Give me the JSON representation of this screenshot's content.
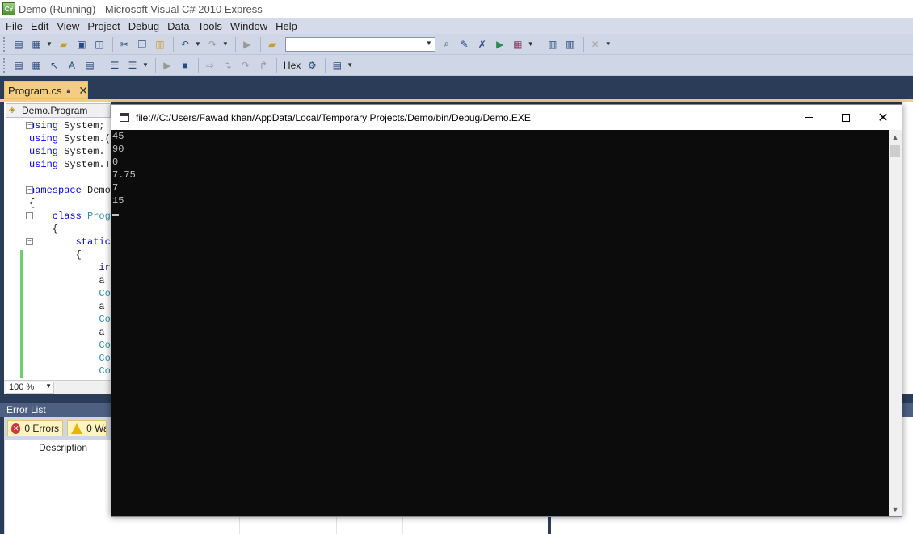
{
  "vs": {
    "title": "Demo (Running) - Microsoft Visual C# 2010 Express",
    "app_icon": "C#"
  },
  "menu": [
    "File",
    "Edit",
    "View",
    "Project",
    "Debug",
    "Data",
    "Tools",
    "Window",
    "Help"
  ],
  "toolbar": {
    "hex_label": "Hex"
  },
  "document_tab": {
    "label": "Program.cs",
    "pin_icon": "lock-icon",
    "close_icon": "close-icon"
  },
  "editor": {
    "nav_label": "Demo.Program",
    "zoom": "100 %",
    "lines": [
      {
        "kw": "using",
        "rest": " System;"
      },
      {
        "kw": "using",
        "rest": " System.("
      },
      {
        "kw": "using",
        "rest": " System."
      },
      {
        "kw": "using",
        "rest": " System.T"
      },
      {
        "kw": "",
        "rest": ""
      },
      {
        "kw": "namespace",
        "rest": " Demo"
      },
      {
        "kw": "",
        "rest": "{"
      },
      {
        "kw": "    class",
        "rest": " Prog"
      },
      {
        "kw": "",
        "rest": "    {"
      },
      {
        "kw": "        static",
        "rest": ""
      },
      {
        "kw": "",
        "rest": "        {"
      },
      {
        "kw": "            ir",
        "rest": ""
      },
      {
        "kw": "",
        "rest": "            a"
      },
      {
        "kw": "",
        "rest": "            Co"
      },
      {
        "kw": "",
        "rest": "            a"
      },
      {
        "kw": "",
        "rest": "            Co"
      },
      {
        "kw": "",
        "rest": "            a"
      },
      {
        "kw": "",
        "rest": "            Co"
      },
      {
        "kw": "",
        "rest": "            Co"
      },
      {
        "kw": "",
        "rest": "            Co"
      }
    ]
  },
  "error_list": {
    "title": "Error List",
    "errors_label": "0 Errors",
    "warnings_label": "0 Wa",
    "description_header": "Description"
  },
  "console": {
    "title": "file:///C:/Users/Fawad khan/AppData/Local/Temporary Projects/Demo/bin/Debug/Demo.EXE",
    "output": [
      "45",
      "90",
      "0",
      "7.75",
      "7",
      "15"
    ],
    "close_glyph": "✕"
  }
}
